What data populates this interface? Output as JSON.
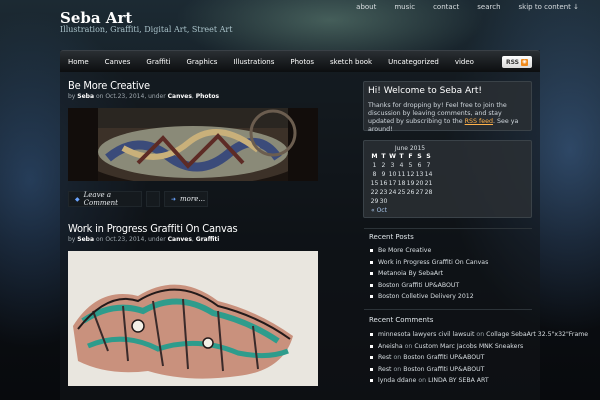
{
  "header": {
    "site_title": "Seba Art",
    "tagline": "Illustration, Graffiti, Digital Art, Street Art",
    "top_menu": [
      "about",
      "music",
      "contact",
      "search",
      "skip to content ↓"
    ]
  },
  "nav": {
    "items": [
      "Home",
      "Canves",
      "Graffiti",
      "Graphics",
      "Illustrations",
      "Photos",
      "sketch book",
      "Uncategorized",
      "video"
    ],
    "rss_label": "RSS"
  },
  "posts": [
    {
      "title": "Be More Creative",
      "meta_prefix": "by",
      "author": "Seba",
      "date_text": "on Oct.23, 2014, under",
      "cat1": "Canves",
      "sep": ",",
      "cat2": "Photos",
      "actions": [
        "Leave a Comment",
        "more..."
      ]
    },
    {
      "title": "Work in Progress Graffiti On Canvas",
      "meta_prefix": "by",
      "author": "Seba",
      "date_text": "on Oct.23, 2014, under",
      "cat1": "Canves",
      "sep": ",",
      "cat2": "Graffiti"
    }
  ],
  "sidebar": {
    "welcome": {
      "title": "Hi! Welcome to Seba Art!",
      "text_before": "Thanks for dropping by! Feel free to join the discussion by leaving comments, and stay updated by subscribing to the",
      "link": "RSS feed",
      "text_after": ". See ya around!"
    },
    "calendar": {
      "caption": "June 2015",
      "headers": [
        "M",
        "T",
        "W",
        "T",
        "F",
        "S",
        "S"
      ],
      "rows": [
        [
          "1",
          "2",
          "3",
          "4",
          "5",
          "6",
          "7"
        ],
        [
          "8",
          "9",
          "10",
          "11",
          "12",
          "13",
          "14"
        ],
        [
          "15",
          "16",
          "17",
          "18",
          "19",
          "20",
          "21"
        ],
        [
          "22",
          "23",
          "24",
          "25",
          "26",
          "27",
          "28"
        ],
        [
          "29",
          "30",
          "",
          "",
          "",
          "",
          ""
        ]
      ],
      "prev": "« Oct"
    },
    "recent_posts": {
      "heading": "Recent Posts",
      "items": [
        "Be More Creative",
        "Work in Progress Graffiti On Canvas",
        "Metanoia By SebaArt",
        "Boston Graffiti UP&ABOUT",
        "Boston Colletive Delivery 2012"
      ]
    },
    "recent_comments": {
      "heading": "Recent Comments",
      "items": [
        {
          "author": "minnesota lawyers civil lawsuit",
          "on": "on",
          "post": "Collage SebaArt 32.5\"x32\"Frame"
        },
        {
          "author": "Aneisha",
          "on": "on",
          "post": "Custom Marc Jacobs MNK Sneakers"
        },
        {
          "author": "Rest",
          "on": "on",
          "post": "Boston Graffiti UP&ABOUT"
        },
        {
          "author": "Rest",
          "on": "on",
          "post": "Boston Graffiti UP&ABOUT"
        },
        {
          "author": "lynda ddane",
          "on": "on",
          "post": "LINDA BY SEBA ART"
        }
      ]
    }
  },
  "colors": {
    "accent_link": "#ffb14a",
    "rss_orange": "#f08a1c",
    "nav_bg": "#1a1e21"
  }
}
